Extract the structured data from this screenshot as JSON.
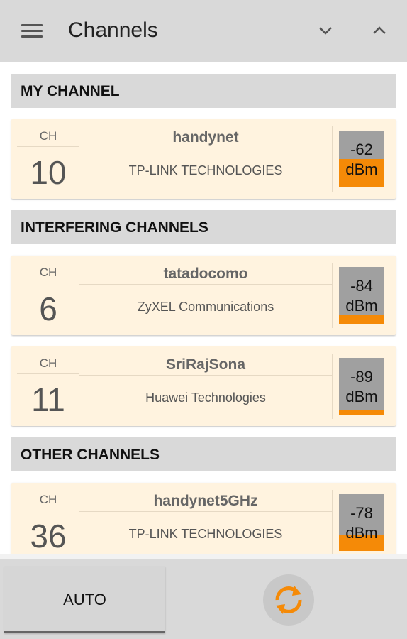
{
  "header": {
    "title": "Channels",
    "icons": {
      "menu": "menu-icon",
      "down": "chevron-down-icon",
      "up": "chevron-up-icon"
    }
  },
  "sections": {
    "my_channel": "MY CHANNEL",
    "interfering": "INTERFERING CHANNELS",
    "other": "OTHER CHANNELS"
  },
  "cards": [
    {
      "ch_label": "CH",
      "channel": "10",
      "ssid": "handynet",
      "vendor": "TP-LINK TECHNOLOGIES",
      "signal": "-62",
      "unit": "dBm",
      "signal_strength_fraction": 0.5
    },
    {
      "ch_label": "CH",
      "channel": "6",
      "ssid": "tatadocomo",
      "vendor": "ZyXEL Communications",
      "signal": "-84",
      "unit": "dBm",
      "signal_strength_fraction": 0.16
    },
    {
      "ch_label": "CH",
      "channel": "11",
      "ssid": "SriRajSona",
      "vendor": "Huawei Technologies",
      "signal": "-89",
      "unit": "dBm",
      "signal_strength_fraction": 0.09
    },
    {
      "ch_label": "CH",
      "channel": "36",
      "ssid": "handynet5GHz",
      "vendor": "TP-LINK TECHNOLOGIES",
      "signal": "-78",
      "unit": "dBm",
      "signal_strength_fraction": 0.27
    }
  ],
  "footer": {
    "auto_label": "AUTO",
    "refresh_icon": "refresh-icon"
  },
  "colors": {
    "accent": "#f58a07",
    "card_bg": "#fff3df",
    "meter_bg": "#a0a0a0"
  }
}
